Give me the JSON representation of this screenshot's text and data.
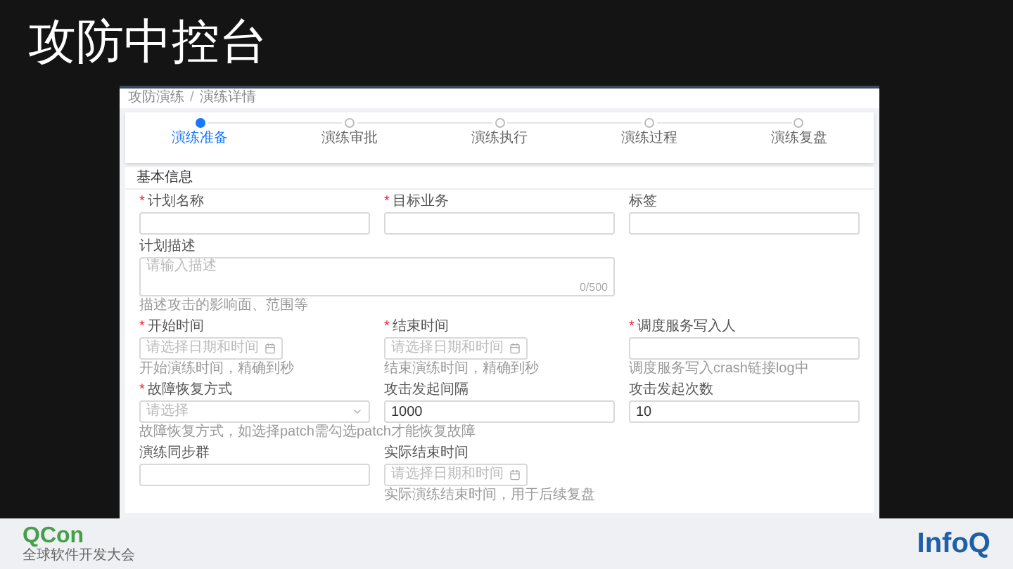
{
  "slide_title": "攻防中控台",
  "screen": {
    "breadcrumb": [
      "攻防演练",
      "演练详情"
    ],
    "breadcrumb_separator": "/",
    "steps": [
      {
        "label": "演练准备",
        "selected": true
      },
      {
        "label": "演练审批",
        "selected": false
      },
      {
        "label": "演练执行",
        "selected": false
      },
      {
        "label": "演练过程",
        "selected": false
      },
      {
        "label": "演练复盘",
        "selected": false
      }
    ],
    "section_title": "基本信息",
    "rows": [
      [
        {
          "kind": "text",
          "label": "计划名称",
          "required_mark": "*"
        },
        {
          "kind": "text",
          "label": "目标业务",
          "required_mark": "*"
        },
        {
          "kind": "text",
          "label": "标签"
        }
      ],
      [
        {
          "kind": "textarea",
          "label": "计划描述",
          "placeholder": "请输入描述",
          "counter": "0/500",
          "hint": "描述攻击的影响面、范围等"
        }
      ],
      [
        {
          "kind": "date",
          "label": "开始时间",
          "required_mark": "*",
          "placeholder": "请选择日期和时间",
          "hint": "开始演练时间，精确到秒"
        },
        {
          "kind": "date",
          "label": "结束时间",
          "required_mark": "*",
          "placeholder": "请选择日期和时间",
          "hint": "结束演练时间，精确到秒"
        },
        {
          "kind": "text",
          "label": "调度服务写入人",
          "required_mark": "*",
          "hint": "调度服务写入crash链接log中"
        }
      ],
      [
        {
          "kind": "select",
          "label": "故障恢复方式",
          "required_mark": "*",
          "placeholder": "请选择",
          "hint": "故障恢复方式，如选择patch需勾选patch才能恢复故障"
        },
        {
          "kind": "text",
          "label": "攻击发起间隔",
          "value": "1000"
        },
        {
          "kind": "text",
          "label": "攻击发起次数",
          "value": "10"
        }
      ],
      [
        {
          "kind": "text",
          "label": "演练同步群"
        },
        {
          "kind": "date",
          "label": "实际结束时间",
          "placeholder": "请选择日期和时间",
          "hint": "实际演练结束时间，用于后续复盘"
        }
      ]
    ]
  },
  "footer": {
    "left_logo": "QCon",
    "left_subtitle": "全球软件开发大会",
    "right_logo": "InfoQ"
  }
}
